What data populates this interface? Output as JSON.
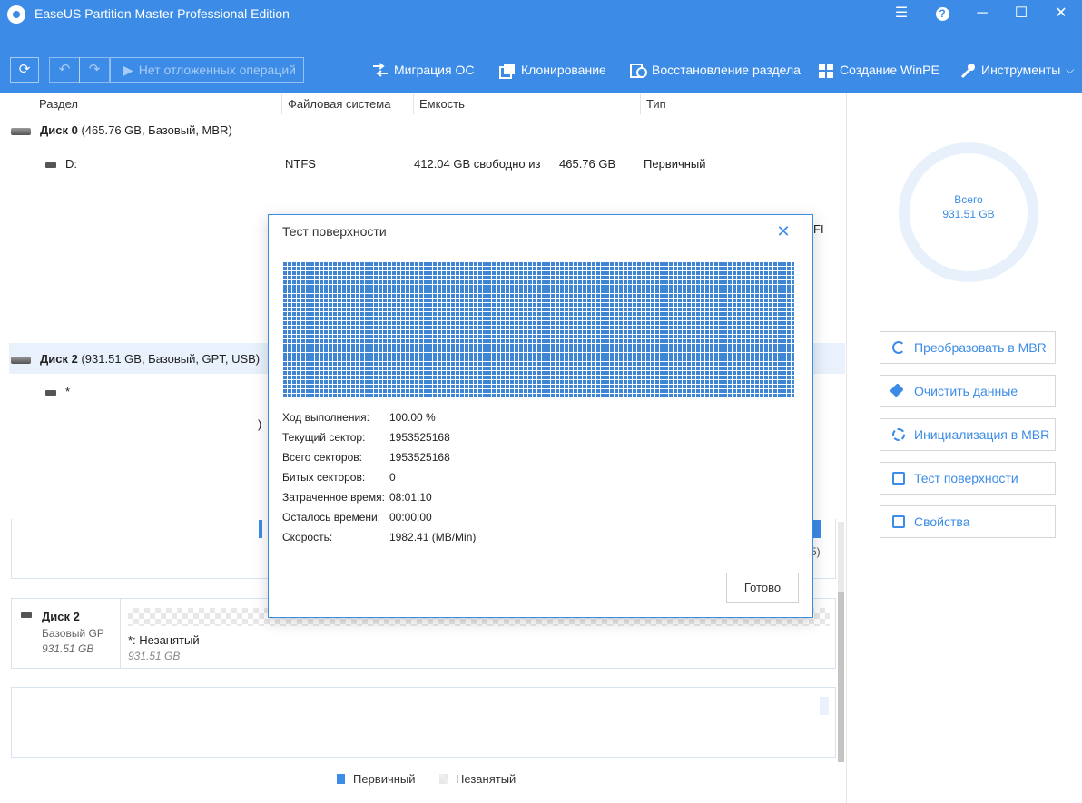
{
  "app": {
    "title": "EaseUS Partition Master Professional Edition"
  },
  "toolbar": {
    "pending": "Нет отложенных операций",
    "items": [
      "Миграция ОС",
      "Клонирование",
      "Восстановление раздела",
      "Создание WinPE",
      "Инструменты"
    ]
  },
  "table": {
    "headers": [
      "Раздел",
      "Файловая система",
      "Емкость",
      "Тип"
    ],
    "disk0": {
      "name": "Диск 0",
      "info": " (465.76 GB, Базовый, MBR)"
    },
    "disk0_part": {
      "name": "D:",
      "fs": "NTFS",
      "free": "412.04 GB свободно из",
      "total": "465.76 GB",
      "type": "Первичный"
    },
    "disk0_partial_type": "FI",
    "disk2": {
      "name": "Диск 2",
      "info": " (931.51 GB, Базовый, GPT, USB)"
    },
    "disk2_part": {
      "name": "*"
    },
    "partial_paren": ")"
  },
  "right_panel": {
    "ring_label": "Всего",
    "ring_value": "931.51 GB",
    "actions": [
      "Преобразовать в MBR",
      "Очистить данные",
      "Инициализация в MBR",
      "Тест поверхности",
      "Свойства"
    ]
  },
  "disk_map": {
    "disk_name": "Диск 2",
    "disk_type": "Базовый GP",
    "disk_size": "931.51 GB",
    "partition_name": "*: Незанятый",
    "partition_size": "931.51 GB",
    "partial_s": "5)"
  },
  "legend": [
    "Первичный",
    "Незанятый"
  ],
  "legend_colors": {
    "primary": "#3c8ce7",
    "unallocated": "#e4e4e4"
  },
  "dialog": {
    "title": "Тест поверхности",
    "stats": [
      {
        "label": "Ход выполнения:",
        "value": "100.00 %"
      },
      {
        "label": "Текущий сектор:",
        "value": "1953525168"
      },
      {
        "label": "Всего секторов:",
        "value": "1953525168"
      },
      {
        "label": "Битых секторов:",
        "value": "0"
      },
      {
        "label": "Затраченное время:",
        "value": "08:01:10"
      },
      {
        "label": "Осталось времени:",
        "value": "00:00:00"
      },
      {
        "label": "Скорость:",
        "value": "1982.41 (MB/Min)"
      }
    ],
    "done": "Готово"
  },
  "colors": {
    "accent": "#3c8ce7",
    "grid": "#3e86d3"
  }
}
